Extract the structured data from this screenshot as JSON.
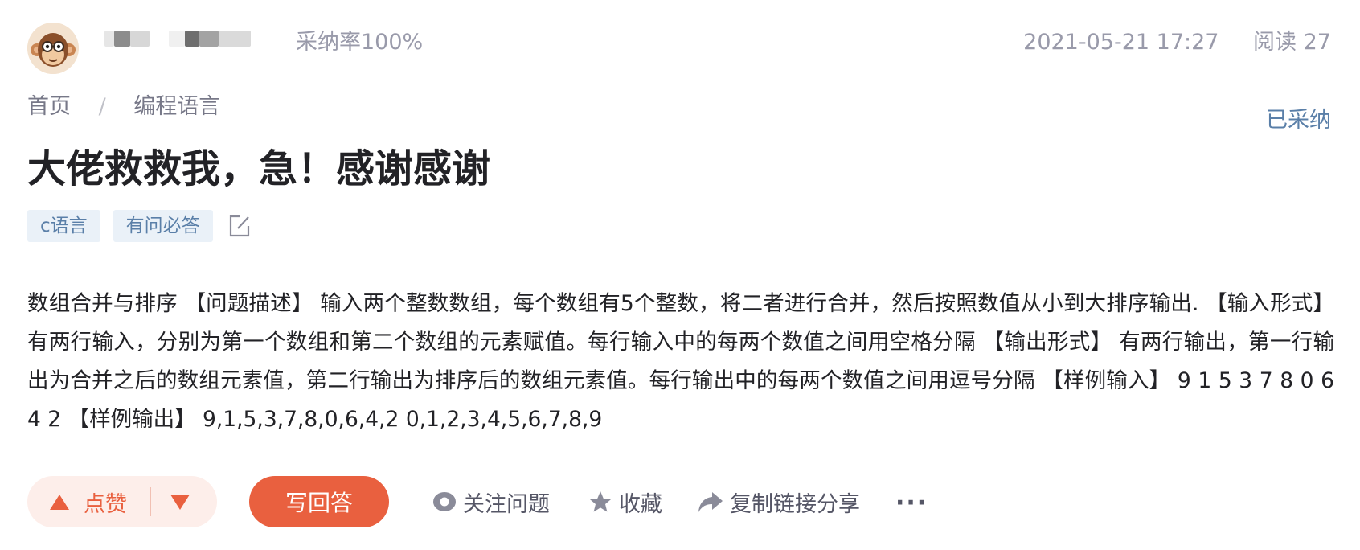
{
  "header": {
    "avatar_icon": "monkey-avatar-icon",
    "accept_rate": "采纳率100%",
    "datetime": "2021-05-21 17:27",
    "views": "阅读 27"
  },
  "breadcrumb": {
    "home": "首页",
    "separator": "/",
    "category": "编程语言"
  },
  "status": {
    "accepted": "已采纳"
  },
  "question": {
    "title": "大佬救救我，急！感谢感谢",
    "tags": [
      "c语言",
      "有问必答"
    ],
    "body": "数组合并与排序 【问题描述】 输入两个整数数组，每个数组有5个整数，将二者进行合并，然后按照数值从小到大排序输出. 【输入形式】 有两行输入，分别为第一个数组和第二个数组的元素赋值。每行输入中的每两个数值之间用空格分隔 【输出形式】 有两行输出，第一行输出为合并之后的数组元素值，第二行输出为排序后的数组元素值。每行输出中的每两个数值之间用逗号分隔 【样例输入】 9 1 5 3 7 8 0 6 4 2 【样例输出】 9,1,5,3,7,8,0,6,4,2 0,1,2,3,4,5,6,7,8,9"
  },
  "actions": {
    "like": "点赞",
    "answer": "写回答",
    "follow": "关注问题",
    "collect": "收藏",
    "share": "复制链接分享",
    "more": "···"
  },
  "colors": {
    "accent": "#e9603f",
    "accent_light": "#fdeeea",
    "tag_bg": "#eaf1f8",
    "tag_text": "#5a7fa8",
    "meta_text": "#999aaa"
  }
}
